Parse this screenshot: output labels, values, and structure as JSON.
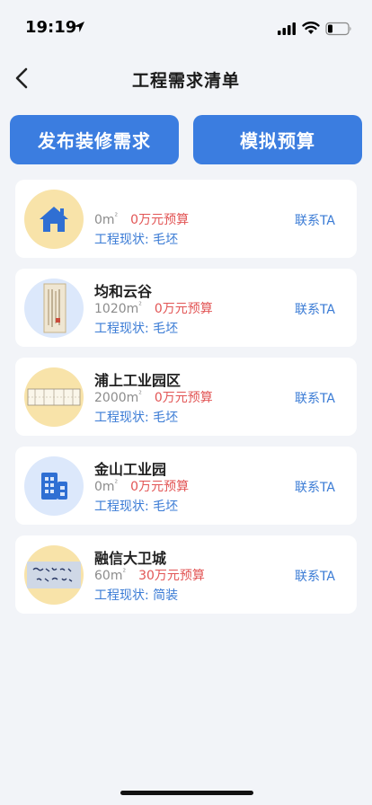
{
  "status": {
    "time": "19:19"
  },
  "header": {
    "title": "工程需求清单"
  },
  "actions": {
    "publish": "发布装修需求",
    "simulate": "模拟预算"
  },
  "projects": [
    {
      "name": "",
      "area": "0m",
      "area_unit": "²",
      "budget": "0万元预算",
      "status": "工程现状: 毛坯",
      "contact": "联系TA",
      "avatar_icon": "house-icon"
    },
    {
      "name": "均和云谷",
      "area": "1020m",
      "area_unit": "²",
      "budget": "0万元预算",
      "status": "工程现状: 毛坯",
      "contact": "联系TA",
      "avatar_icon": "document-photo"
    },
    {
      "name": "浦上工业园区",
      "area": "2000m",
      "area_unit": "²",
      "budget": "0万元预算",
      "status": "工程现状: 毛坯",
      "contact": "联系TA",
      "avatar_icon": "floorplan-photo"
    },
    {
      "name": "金山工业园",
      "area": "0m",
      "area_unit": "²",
      "budget": "0万元预算",
      "status": "工程现状: 毛坯",
      "contact": "联系TA",
      "avatar_icon": "building-icon"
    },
    {
      "name": "融信大卫城",
      "area": "60m",
      "area_unit": "²",
      "budget": "30万元预算",
      "status": "工程现状: 简装",
      "contact": "联系TA",
      "avatar_icon": "calligraphy-photo"
    }
  ],
  "colors": {
    "accent": "#3b7de0",
    "budget": "#e25555",
    "link": "#3a7bd5"
  }
}
